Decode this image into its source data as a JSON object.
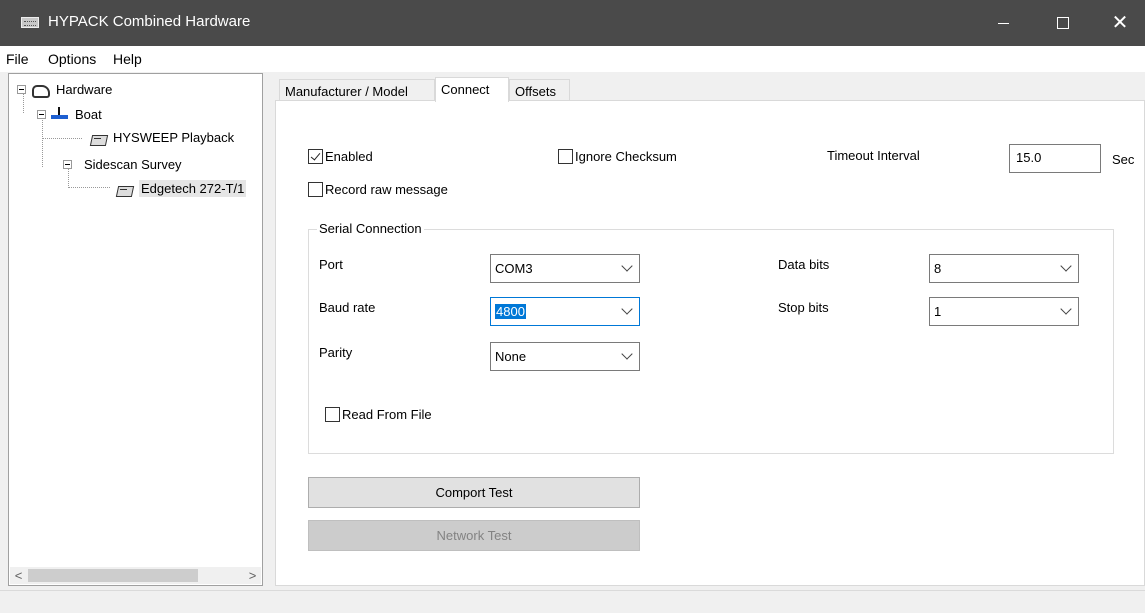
{
  "window": {
    "title": "HYPACK Combined Hardware"
  },
  "menu": [
    "File",
    "Options",
    "Help"
  ],
  "tree": {
    "root": "Hardware",
    "boat": "Boat",
    "hysweep": "HYSWEEP Playback",
    "sidescan": "Sidescan Survey",
    "device": "Edgetech 272-T/1"
  },
  "tabs": [
    "Manufacturer / Model",
    "Connect",
    "Offsets"
  ],
  "connect": {
    "enabled_label": "Enabled",
    "enabled_checked": true,
    "ignore_checksum_label": "Ignore Checksum",
    "ignore_checksum_checked": false,
    "timeout_label": "Timeout Interval",
    "timeout_value": "15.0",
    "timeout_unit": "Sec",
    "record_raw_label": "Record raw message",
    "record_raw_checked": false
  },
  "serial": {
    "title": "Serial Connection",
    "port_label": "Port",
    "port_value": "COM3",
    "baud_label": "Baud rate",
    "baud_value": "4800",
    "parity_label": "Parity",
    "parity_value": "None",
    "databits_label": "Data bits",
    "databits_value": "8",
    "stopbits_label": "Stop bits",
    "stopbits_value": "1",
    "read_file_label": "Read From File",
    "read_file_checked": false
  },
  "buttons": {
    "comport_test": "Comport Test",
    "network_test": "Network Test"
  }
}
